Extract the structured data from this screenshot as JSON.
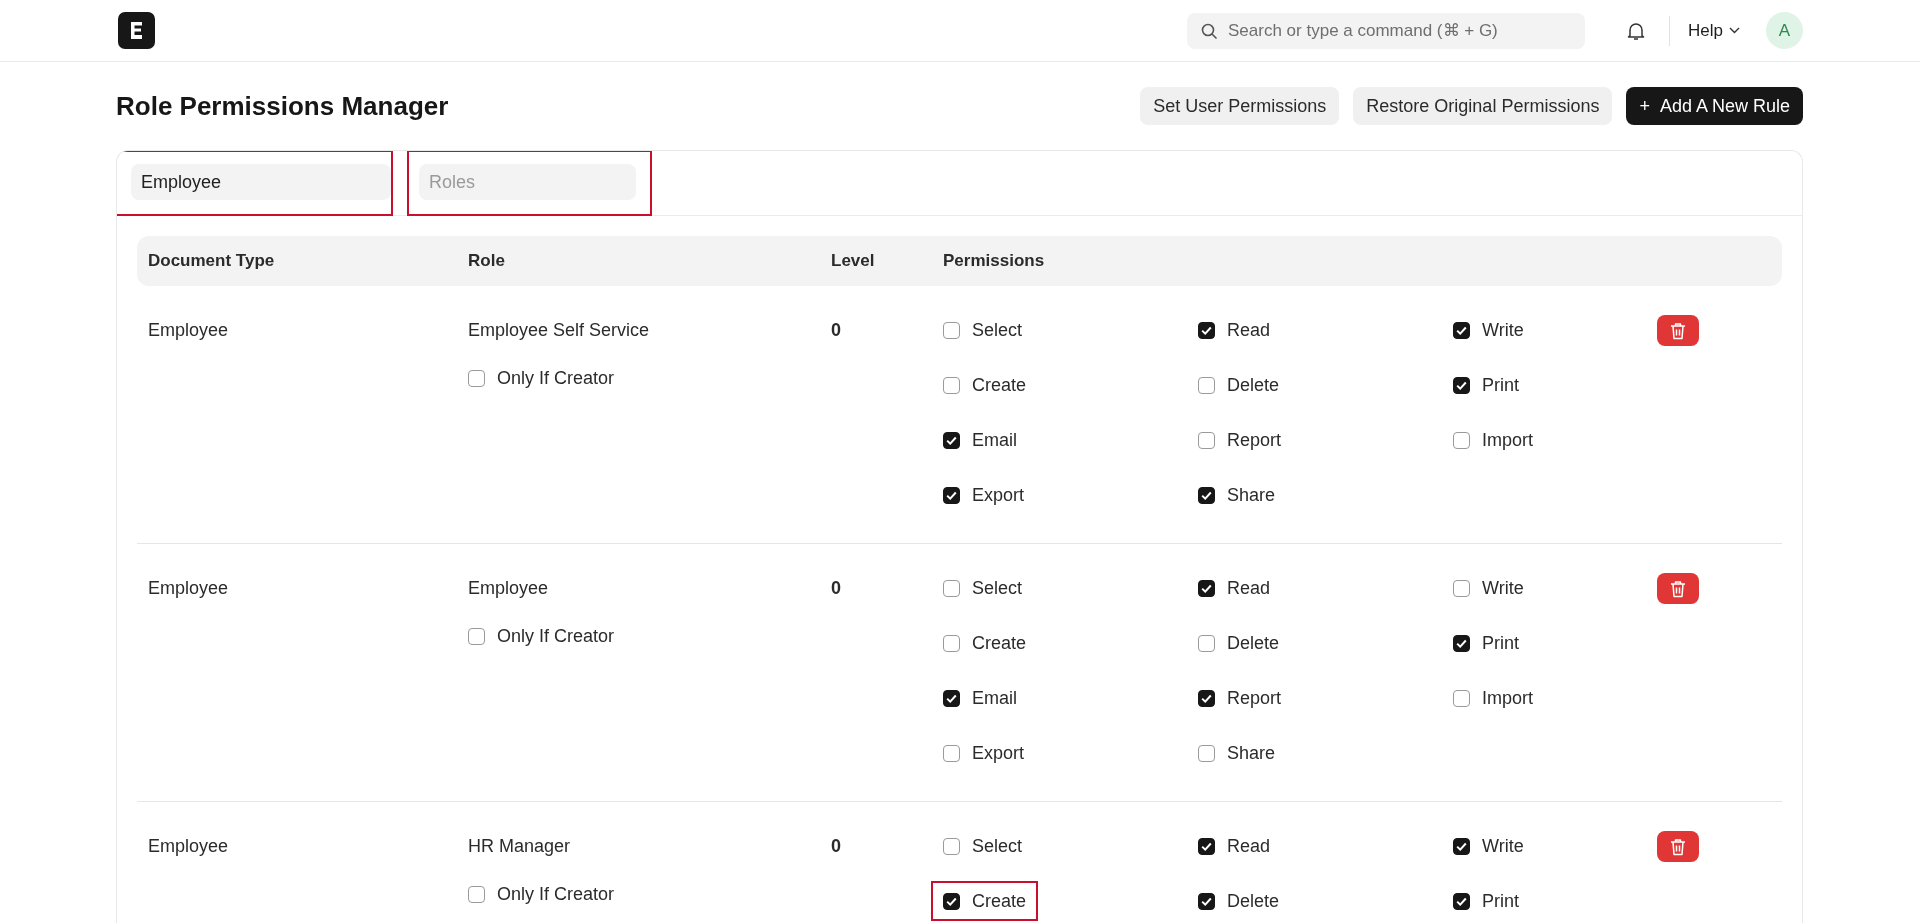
{
  "navbar": {
    "search": {
      "placeholder": "Search or type a command (⌘ + G)"
    },
    "help": "Help",
    "avatar": "A"
  },
  "page": {
    "title": "Role Permissions Manager",
    "actions": [
      {
        "label": "Set User Permissions",
        "kind": "secondary"
      },
      {
        "label": "Restore Original Permissions",
        "kind": "secondary"
      },
      {
        "label": "Add A New Rule",
        "kind": "primary",
        "icon": "+"
      }
    ]
  },
  "filters": [
    {
      "value": "Employee",
      "highlighted": true
    },
    {
      "placeholder": "Roles",
      "highlighted": true
    }
  ],
  "table": {
    "columns": [
      "Document Type",
      "Role",
      "Level",
      "Permissions"
    ],
    "rows": [
      {
        "document_type": "Employee",
        "role": "Employee Self Service",
        "only_if_creator": {
          "label": "Only If Creator",
          "checked": false
        },
        "level": "0",
        "permissions": [
          {
            "label": "Select",
            "checked": false,
            "highlighted": false
          },
          {
            "label": "Read",
            "checked": true,
            "highlighted": false
          },
          {
            "label": "Write",
            "checked": true,
            "highlighted": false
          },
          {
            "label": "Create",
            "checked": false,
            "highlighted": false
          },
          {
            "label": "Delete",
            "checked": false,
            "highlighted": false
          },
          {
            "label": "Print",
            "checked": true,
            "highlighted": false
          },
          {
            "label": "Email",
            "checked": true,
            "highlighted": false
          },
          {
            "label": "Report",
            "checked": false,
            "highlighted": false
          },
          {
            "label": "Import",
            "checked": false,
            "highlighted": false
          },
          {
            "label": "Export",
            "checked": true,
            "highlighted": false
          },
          {
            "label": "Share",
            "checked": true,
            "highlighted": false
          }
        ]
      },
      {
        "document_type": "Employee",
        "role": "Employee",
        "only_if_creator": {
          "label": "Only If Creator",
          "checked": false
        },
        "level": "0",
        "permissions": [
          {
            "label": "Select",
            "checked": false,
            "highlighted": false
          },
          {
            "label": "Read",
            "checked": true,
            "highlighted": false
          },
          {
            "label": "Write",
            "checked": false,
            "highlighted": false
          },
          {
            "label": "Create",
            "checked": false,
            "highlighted": false
          },
          {
            "label": "Delete",
            "checked": false,
            "highlighted": false
          },
          {
            "label": "Print",
            "checked": true,
            "highlighted": false
          },
          {
            "label": "Email",
            "checked": true,
            "highlighted": false
          },
          {
            "label": "Report",
            "checked": true,
            "highlighted": false
          },
          {
            "label": "Import",
            "checked": false,
            "highlighted": false
          },
          {
            "label": "Export",
            "checked": false,
            "highlighted": false
          },
          {
            "label": "Share",
            "checked": false,
            "highlighted": false
          }
        ]
      },
      {
        "document_type": "Employee",
        "role": "HR Manager",
        "only_if_creator": {
          "label": "Only If Creator",
          "checked": false
        },
        "level": "0",
        "permissions": [
          {
            "label": "Select",
            "checked": false,
            "highlighted": false
          },
          {
            "label": "Read",
            "checked": true,
            "highlighted": false
          },
          {
            "label": "Write",
            "checked": true,
            "highlighted": false
          },
          {
            "label": "Create",
            "checked": true,
            "highlighted": true
          },
          {
            "label": "Delete",
            "checked": true,
            "highlighted": false
          },
          {
            "label": "Print",
            "checked": true,
            "highlighted": false
          }
        ]
      }
    ]
  }
}
